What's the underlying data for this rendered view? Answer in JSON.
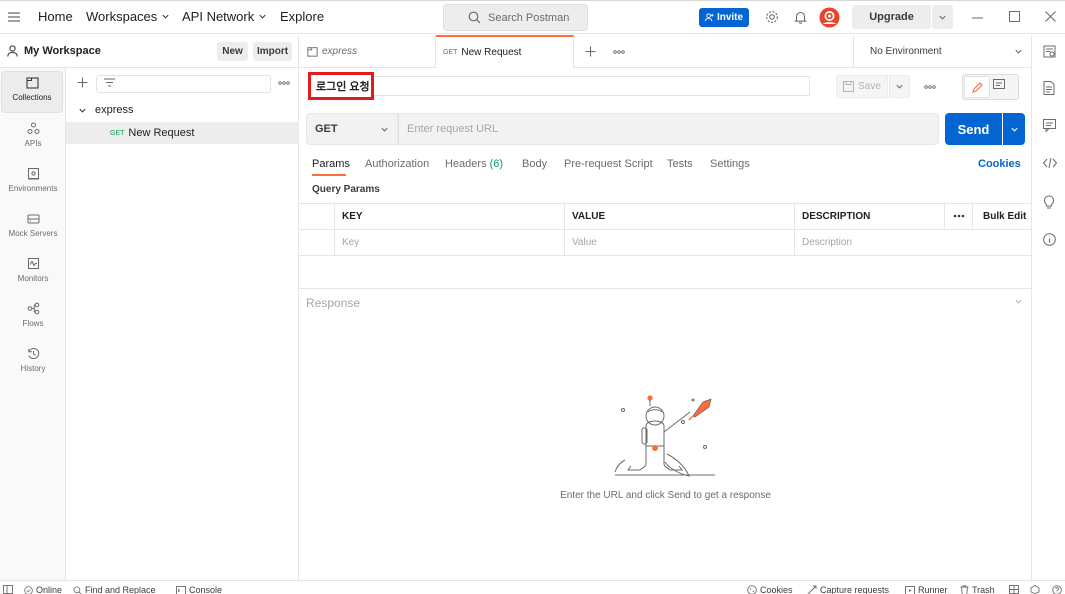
{
  "header": {
    "nav": [
      "Home",
      "Workspaces",
      "API Network",
      "Explore"
    ],
    "search_placeholder": "Search Postman",
    "invite_label": "Invite",
    "upgrade_label": "Upgrade"
  },
  "workspace": {
    "title": "My Workspace",
    "new_label": "New",
    "import_label": "Import"
  },
  "rail": {
    "items": [
      {
        "label": "Collections",
        "icon": "collections-icon",
        "active": true
      },
      {
        "label": "APIs",
        "icon": "apis-icon"
      },
      {
        "label": "Environments",
        "icon": "environments-icon"
      },
      {
        "label": "Mock Servers",
        "icon": "mock-servers-icon"
      },
      {
        "label": "Monitors",
        "icon": "monitors-icon"
      },
      {
        "label": "Flows",
        "icon": "flows-icon"
      },
      {
        "label": "History",
        "icon": "history-icon"
      }
    ]
  },
  "tree": {
    "collection": "express",
    "request_method": "GET",
    "request_name": "New Request"
  },
  "tabs": [
    {
      "label": "express",
      "italic": true
    },
    {
      "method": "GET",
      "label": "New Request",
      "active": true
    }
  ],
  "environment": "No Environment",
  "request": {
    "name": "로그인 요청",
    "save_label": "Save",
    "method": "GET",
    "url_placeholder": "Enter request URL",
    "send_label": "Send"
  },
  "request_tabs": [
    {
      "label": "Params",
      "active": true
    },
    {
      "label": "Authorization"
    },
    {
      "label": "Headers",
      "count": "(6)"
    },
    {
      "label": "Body"
    },
    {
      "label": "Pre-request Script"
    },
    {
      "label": "Tests"
    },
    {
      "label": "Settings"
    }
  ],
  "cookies_label": "Cookies",
  "params": {
    "section_title": "Query Params",
    "columns": [
      "KEY",
      "VALUE",
      "DESCRIPTION"
    ],
    "bulk_edit": "Bulk Edit",
    "placeholders": [
      "Key",
      "Value",
      "Description"
    ]
  },
  "response": {
    "label": "Response",
    "empty_message": "Enter the URL and click Send to get a response"
  },
  "footer": {
    "online": "Online",
    "find_replace": "Find and Replace",
    "console": "Console",
    "cookies": "Cookies",
    "capture": "Capture requests",
    "runner": "Runner",
    "trash": "Trash"
  },
  "colors": {
    "accent": "#ff6c37",
    "primary": "#0265d2",
    "highlight_box": "#e41b1b",
    "get_method": "#0f9d58"
  }
}
